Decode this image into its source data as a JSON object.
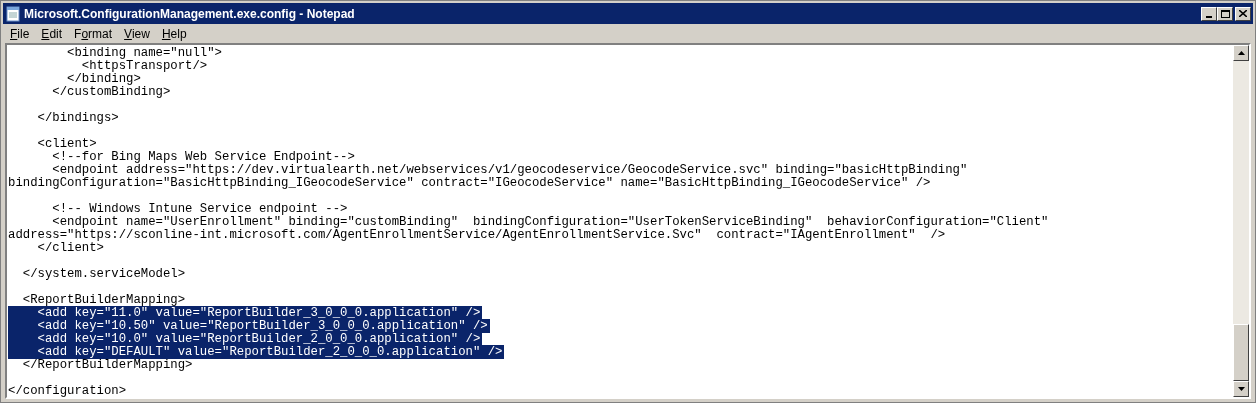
{
  "window": {
    "title": "Microsoft.ConfigurationManagement.exe.config - Notepad"
  },
  "menu": [
    {
      "parts": [
        {
          "text": "F",
          "underlined": true
        },
        {
          "text": "ile",
          "underlined": false
        }
      ]
    },
    {
      "parts": [
        {
          "text": "E",
          "underlined": true
        },
        {
          "text": "dit",
          "underlined": false
        }
      ]
    },
    {
      "parts": [
        {
          "text": "F",
          "underlined": false
        },
        {
          "text": "o",
          "underlined": true
        },
        {
          "text": "rmat",
          "underlined": false
        }
      ]
    },
    {
      "parts": [
        {
          "text": "V",
          "underlined": true
        },
        {
          "text": "iew",
          "underlined": false
        }
      ]
    },
    {
      "parts": [
        {
          "text": "H",
          "underlined": true
        },
        {
          "text": "elp",
          "underlined": false
        }
      ]
    }
  ],
  "lines": [
    {
      "kind": "text",
      "text": "        <binding name=\"null\">",
      "selected": false
    },
    {
      "kind": "text",
      "text": "          <httpsTransport/>",
      "selected": false
    },
    {
      "kind": "text",
      "text": "        </binding>",
      "selected": false
    },
    {
      "kind": "text",
      "text": "      </customBinding>",
      "selected": false
    },
    {
      "kind": "blank"
    },
    {
      "kind": "text",
      "text": "    </bindings>",
      "selected": false
    },
    {
      "kind": "blank"
    },
    {
      "kind": "text",
      "text": "    <client>",
      "selected": false
    },
    {
      "kind": "text",
      "text": "      <!--for Bing Maps Web Service Endpoint-->",
      "selected": false
    },
    {
      "kind": "text",
      "text": "      <endpoint address=\"https://dev.virtualearth.net/webservices/v1/geocodeservice/GeocodeService.svc\" binding=\"basicHttpBinding\"",
      "selected": false
    },
    {
      "kind": "text",
      "text": "bindingConfiguration=\"BasicHttpBinding_IGeocodeService\" contract=\"IGeocodeService\" name=\"BasicHttpBinding_IGeocodeService\" />",
      "selected": false
    },
    {
      "kind": "blank"
    },
    {
      "kind": "text",
      "text": "      <!-- Windows Intune Service endpoint -->",
      "selected": false
    },
    {
      "kind": "text",
      "text": "      <endpoint name=\"UserEnrollment\" binding=\"customBinding\"  bindingConfiguration=\"UserTokenServiceBinding\"  behaviorConfiguration=\"Client\"",
      "selected": false
    },
    {
      "kind": "text",
      "text": "address=\"https://sconline-int.microsoft.com/AgentEnrollmentService/AgentEnrollmentService.Svc\"  contract=\"IAgentEnrollment\"  />",
      "selected": false
    },
    {
      "kind": "text",
      "text": "    </client>",
      "selected": false
    },
    {
      "kind": "blank"
    },
    {
      "kind": "text",
      "text": "  </system.serviceModel>",
      "selected": false
    },
    {
      "kind": "blank"
    },
    {
      "kind": "text",
      "text": "  <ReportBuilderMapping>",
      "selected": false
    },
    {
      "kind": "text",
      "text": "    <add key=\"11.0\" value=\"ReportBuilder_3_0_0_0.application\" />",
      "selected": true
    },
    {
      "kind": "text",
      "text": "    <add key=\"10.50\" value=\"ReportBuilder_3_0_0_0.application\" />",
      "selected": true
    },
    {
      "kind": "text",
      "text": "    <add key=\"10.0\" value=\"ReportBuilder_2_0_0_0.application\" />",
      "selected": true
    },
    {
      "kind": "text",
      "text": "    <add key=\"DEFAULT\" value=\"ReportBuilder_2_0_0_0.application\" />",
      "selected": true
    },
    {
      "kind": "text",
      "text": "  </ReportBuilderMapping>",
      "selected": false
    },
    {
      "kind": "blank"
    },
    {
      "kind": "text",
      "text": "</configuration>",
      "selected": false
    }
  ]
}
